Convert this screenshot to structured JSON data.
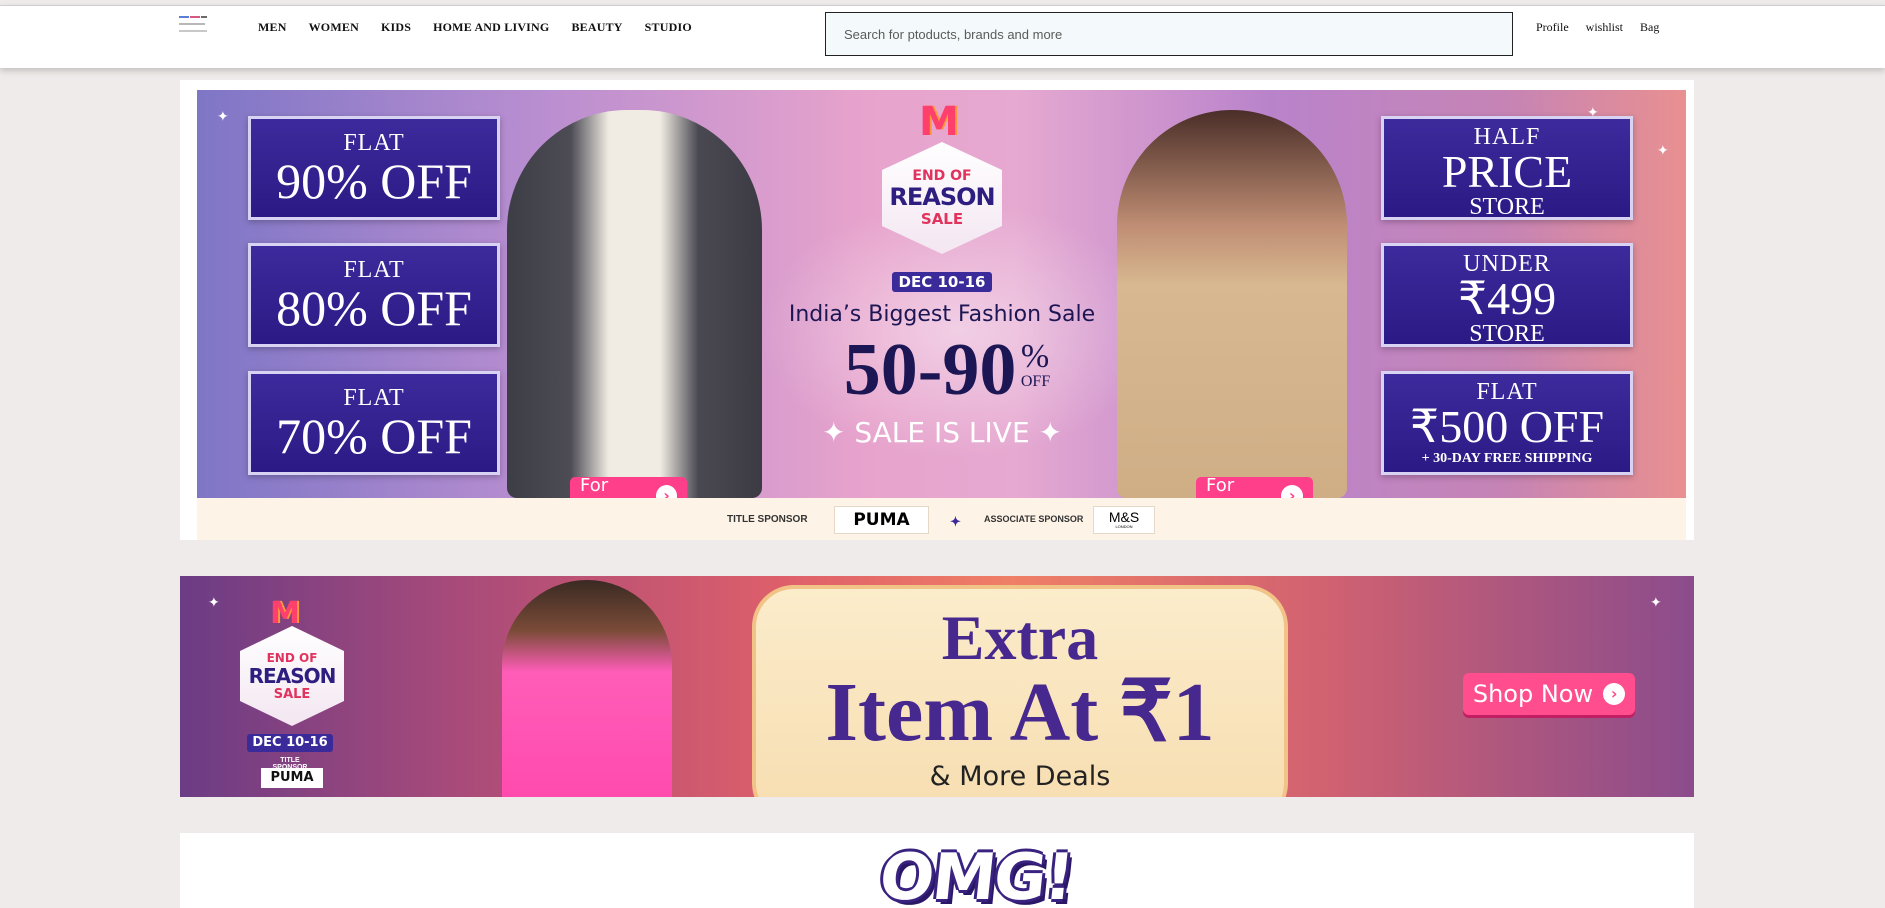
{
  "header": {
    "logo_name": "myntra-logo",
    "nav": [
      "MEN",
      "WOMEN",
      "KIDS",
      "HOME AND LIVING",
      "BEAUTY",
      "STUDIO"
    ],
    "search_placeholder": "Search for ptoducts, brands and more",
    "user_links": [
      "Profile",
      "wishlist",
      "Bag"
    ]
  },
  "hero_banner": {
    "left_offers": [
      {
        "top": "FLAT",
        "main": "90% OFF"
      },
      {
        "top": "FLAT",
        "main": "80% OFF"
      },
      {
        "top": "FLAT",
        "main": "70% OFF"
      }
    ],
    "right_offers": [
      {
        "top": "HALF",
        "main": "PRICE",
        "bottom": "STORE"
      },
      {
        "top": "UNDER",
        "main": "₹499",
        "bottom": "STORE"
      },
      {
        "top": "FLAT",
        "main": "₹500 OFF",
        "bottom": "+ 30-DAY FREE SHIPPING"
      }
    ],
    "badge": {
      "line1": "END OF",
      "line2": "REASON",
      "line3": "SALE"
    },
    "date": "DEC 10-16",
    "headline": "India’s Biggest Fashion Sale",
    "discount": "50-90",
    "discount_pct": "%",
    "discount_off": "OFF",
    "live": "✦ SALE IS LIVE ✦",
    "for_him": "For Him",
    "for_her": "For Her",
    "sponsor": {
      "title_label": "TITLE SPONSOR",
      "title_brand": "PUMA",
      "associate_label": "ASSOCIATE SPONSOR",
      "associate_brand": "M&S",
      "associate_sub": "LONDON"
    }
  },
  "second_banner": {
    "badge": {
      "line1": "END OF",
      "line2": "REASON",
      "line3": "SALE"
    },
    "date": "DEC 10-16",
    "title_sponsor_label": "TITLE SPONSOR",
    "title_sponsor_brand": "PUMA",
    "extra": "Extra",
    "item": "Item At ₹1",
    "more": "& More Deals",
    "cta": "Shop Now"
  },
  "third_banner": {
    "text": "OMG!"
  },
  "colors": {
    "accent_pink": "#ff3f8a",
    "offer_purple": "#2b1a85",
    "brand_pink": "#ff3f6c"
  }
}
